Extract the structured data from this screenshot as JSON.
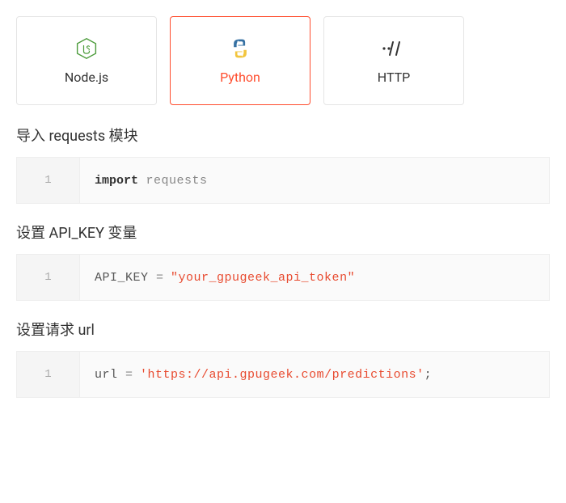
{
  "tabs": [
    {
      "label": "Node.js",
      "active": false
    },
    {
      "label": "Python",
      "active": true
    },
    {
      "label": "HTTP",
      "active": false
    }
  ],
  "sections": [
    {
      "title": "导入 requests 模块",
      "lineNo": "1",
      "code": {
        "kw": "import",
        "rest": " requests"
      }
    },
    {
      "title": "设置 API_KEY 变量",
      "lineNo": "1",
      "code": {
        "lhs": "API_KEY ",
        "op": "= ",
        "str": "\"your_gpugeek_api_token\""
      }
    },
    {
      "title": "设置请求 url",
      "lineNo": "1",
      "code": {
        "lhs": "url ",
        "op": "= ",
        "str": "'https://api.gpugeek.com/predictions'",
        "trail": ";"
      }
    }
  ]
}
